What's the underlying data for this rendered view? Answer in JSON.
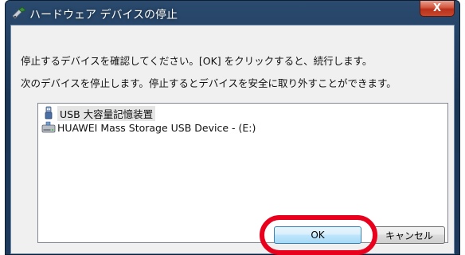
{
  "window": {
    "title": "ハードウェア デバイスの停止",
    "close_label": "X"
  },
  "message": {
    "line1": "停止するデバイスを確認してください。[OK] をクリックすると、続行します。",
    "line2": "次のデバイスを停止します。停止するとデバイスを安全に取り外すことができます。"
  },
  "devices": [
    {
      "label": "USB 大容量記憶装置",
      "icon": "usb-plug-icon"
    },
    {
      "label": "HUAWEI Mass Storage USB Device - (E:)",
      "icon": "drive-icon"
    }
  ],
  "buttons": {
    "ok": "OK",
    "cancel": "キャンセル"
  },
  "colors": {
    "highlight": "#e8001c"
  }
}
